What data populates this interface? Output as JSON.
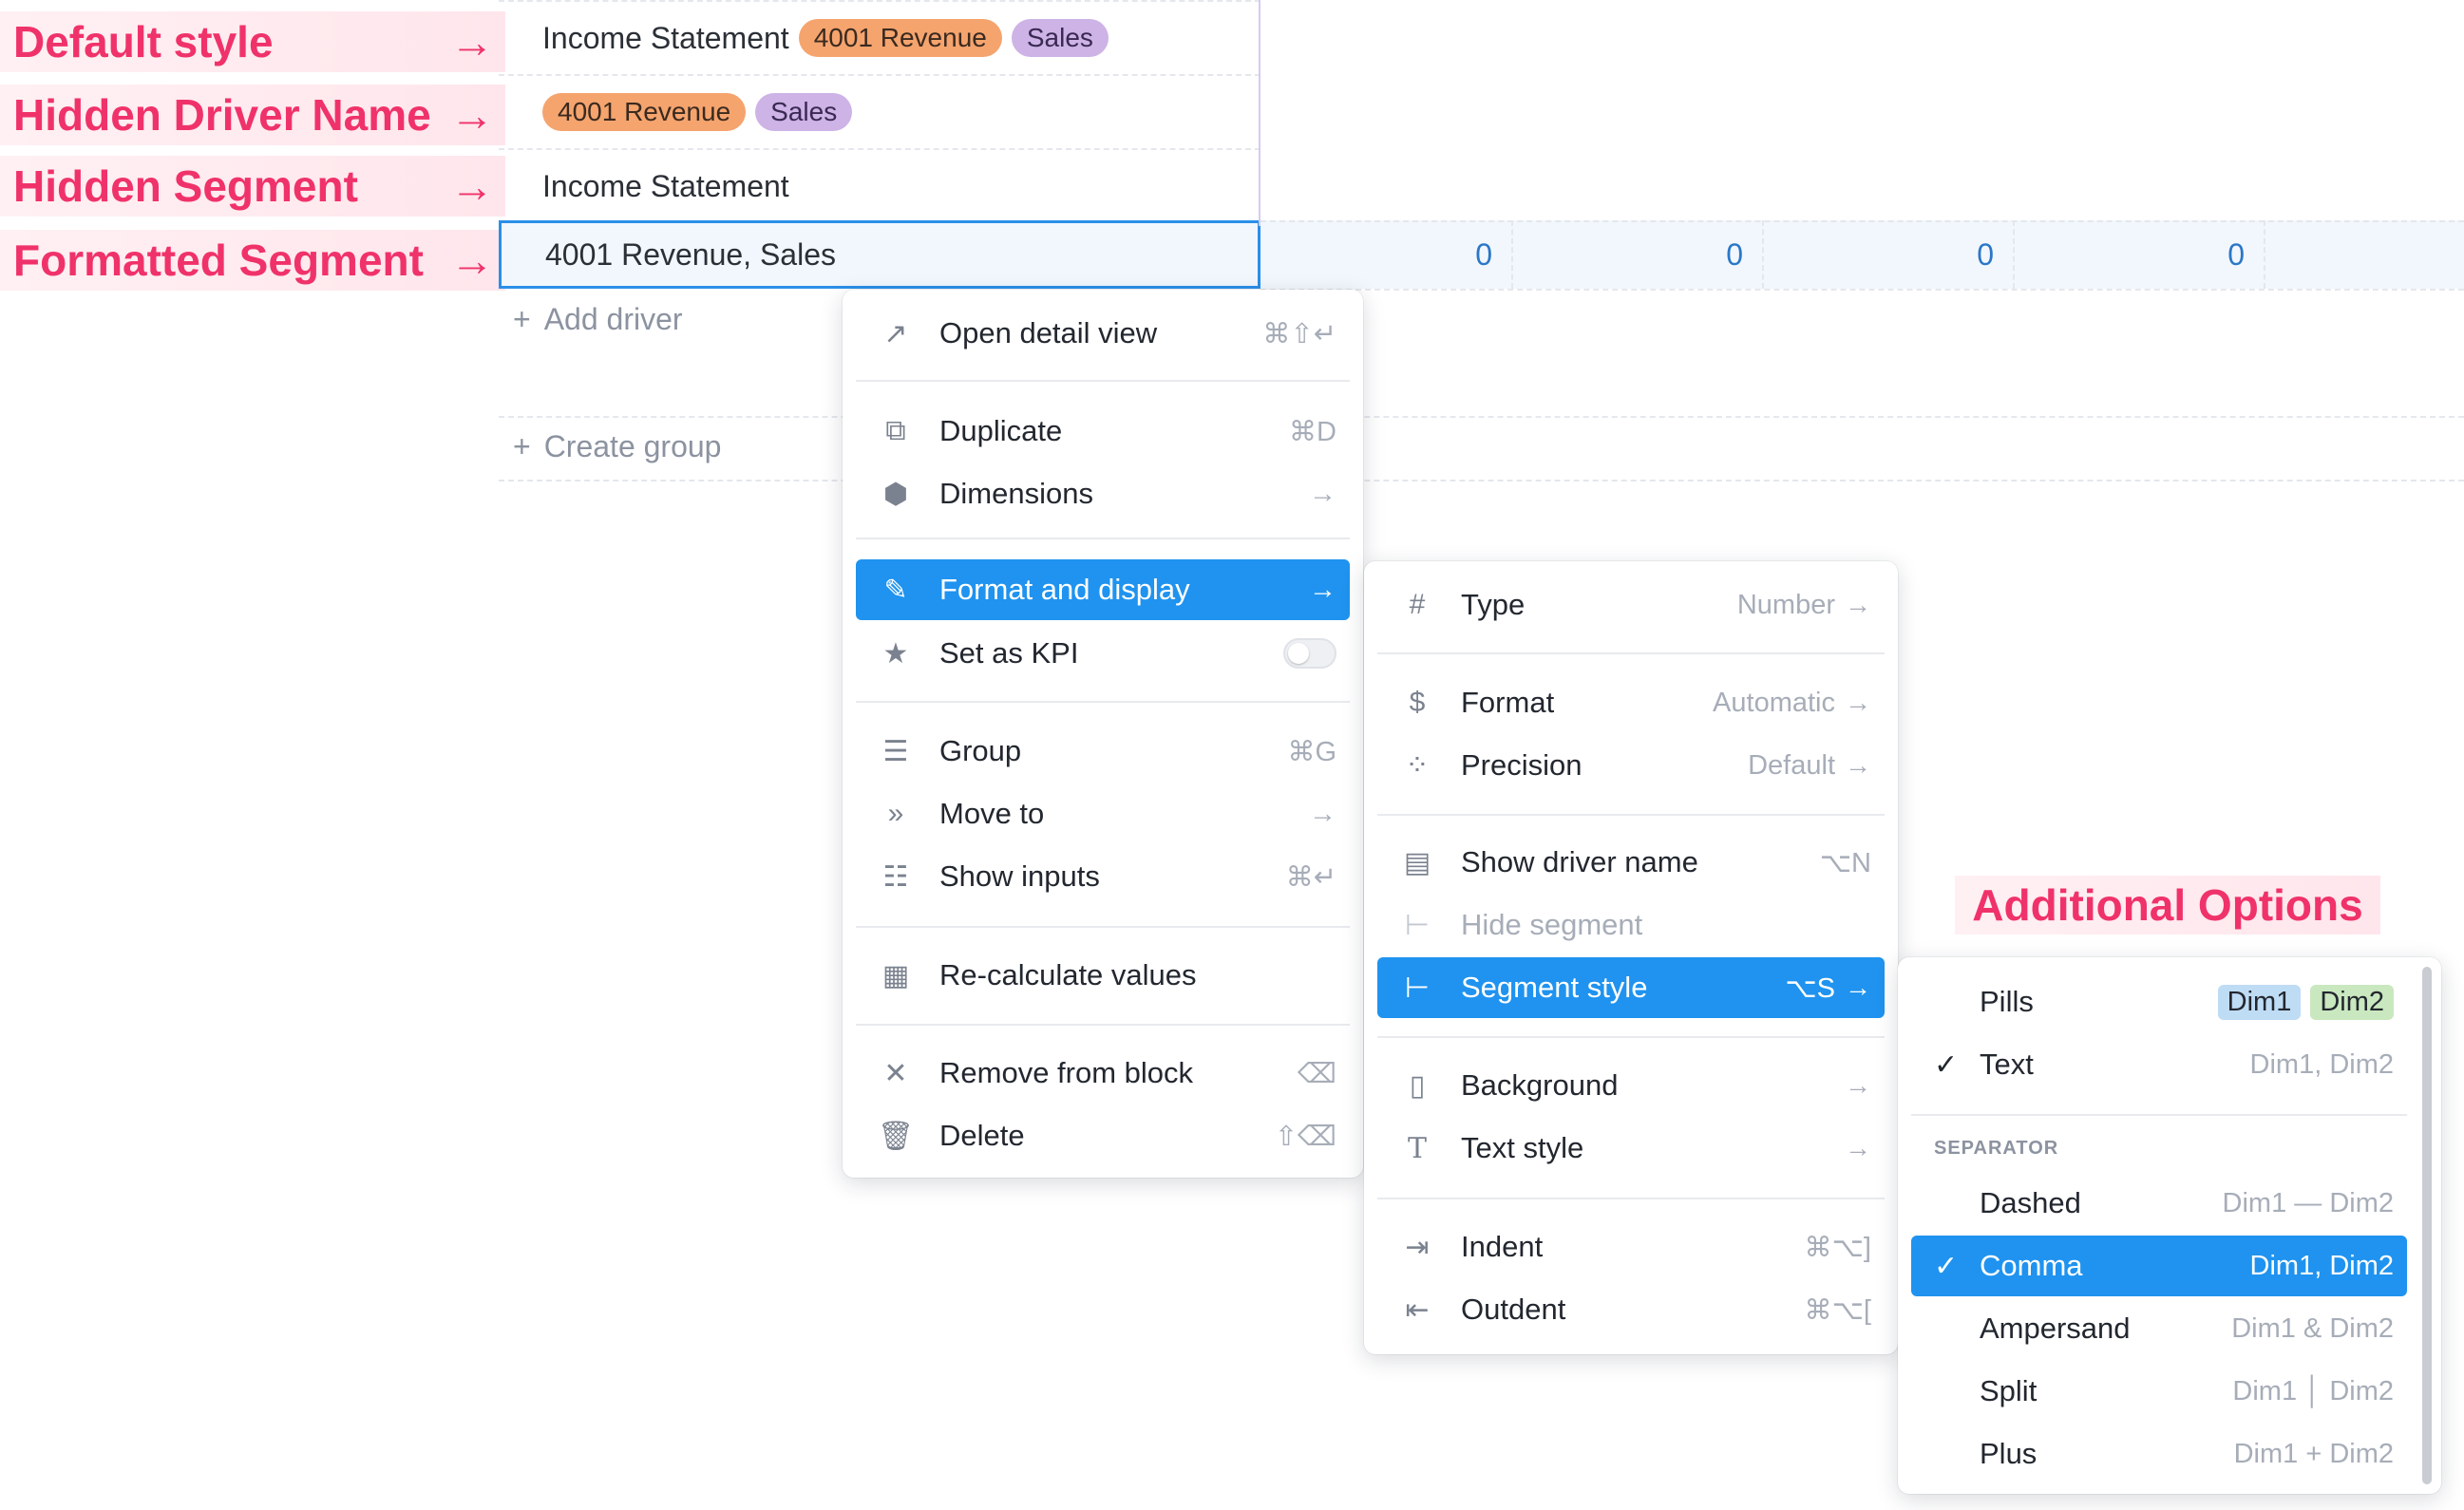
{
  "annotations": [
    {
      "label": "Default style"
    },
    {
      "label": "Hidden Driver Name"
    },
    {
      "label": "Hidden Segment"
    },
    {
      "label": "Formatted Segment"
    }
  ],
  "arrow": "→",
  "grid": {
    "rows": [
      {
        "name": "Income Statement",
        "pills": [
          "4001 Revenue",
          "Sales"
        ]
      },
      {
        "name": "",
        "pills": [
          "4001 Revenue",
          "Sales"
        ]
      },
      {
        "name": "Income Statement",
        "pills": []
      },
      {
        "name": "4001 Revenue, Sales",
        "pills": []
      }
    ],
    "values": [
      "0",
      "0",
      "0",
      "0"
    ],
    "add_driver": "Add driver",
    "create_group": "Create group"
  },
  "context_menu": {
    "items": [
      {
        "label": "Open detail view",
        "hint": "⌘⇧↵",
        "icon": "arrow-up-right-icon"
      },
      {
        "label": "Duplicate",
        "hint": "⌘D",
        "icon": "duplicate-icon"
      },
      {
        "label": "Dimensions",
        "hint": "→",
        "icon": "cube-icon"
      },
      {
        "label": "Format and display",
        "hint": "→",
        "icon": "format-icon"
      },
      {
        "label": "Set as KPI",
        "hint": "",
        "icon": "star-icon"
      },
      {
        "label": "Group",
        "hint": "⌘G",
        "icon": "group-icon"
      },
      {
        "label": "Move to",
        "hint": "→",
        "icon": "move-icon"
      },
      {
        "label": "Show inputs",
        "hint": "⌘↵",
        "icon": "inputs-icon"
      },
      {
        "label": "Re-calculate values",
        "hint": "",
        "icon": "calculator-icon"
      },
      {
        "label": "Remove from block",
        "hint": "⌫",
        "icon": "close-icon"
      },
      {
        "label": "Delete",
        "hint": "⇧⌫",
        "icon": "trash-icon"
      }
    ]
  },
  "format_menu": {
    "items": [
      {
        "label": "Type",
        "hint": "Number",
        "icon": "hash-icon"
      },
      {
        "label": "Format",
        "hint": "Automatic",
        "icon": "dollar-icon"
      },
      {
        "label": "Precision",
        "hint": "Default",
        "icon": "precision-icon"
      },
      {
        "label": "Show driver name",
        "hint": "⌥N",
        "icon": "text-block-icon"
      },
      {
        "label": "Hide segment",
        "hint": "",
        "icon": "segment-icon"
      },
      {
        "label": "Segment style",
        "hint": "⌥S",
        "icon": "segment-icon"
      },
      {
        "label": "Background",
        "hint": "",
        "icon": "paint-icon"
      },
      {
        "label": "Text style",
        "hint": "",
        "icon": "text-icon"
      },
      {
        "label": "Indent",
        "hint": "⌘⌥]",
        "icon": "indent-icon"
      },
      {
        "label": "Outdent",
        "hint": "⌘⌥[",
        "icon": "outdent-icon"
      }
    ]
  },
  "segment_menu": {
    "title": "Additional Options",
    "style_items": [
      {
        "label": "Pills",
        "tag1": "Dim1",
        "tag2": "Dim2"
      },
      {
        "label": "Text",
        "preview": "Dim1, Dim2",
        "checked": true
      }
    ],
    "separator_label": "SEPARATOR",
    "separator_items": [
      {
        "label": "Dashed",
        "preview": "Dim1 — Dim2"
      },
      {
        "label": "Comma",
        "preview": "Dim1, Dim2",
        "checked": true
      },
      {
        "label": "Ampersand",
        "preview": "Dim1 & Dim2"
      },
      {
        "label": "Split",
        "preview": "Dim1 │ Dim2"
      },
      {
        "label": "Plus",
        "preview": "Dim1 + Dim2"
      }
    ]
  },
  "colors": {
    "accent": "#1f93ef",
    "annotation": "#f0326a"
  }
}
